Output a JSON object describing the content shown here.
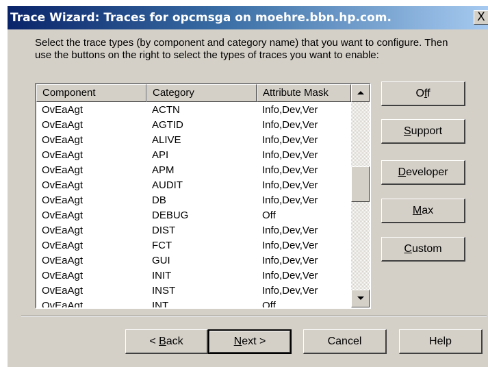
{
  "window": {
    "title": "Trace Wizard: Traces for opcmsga on moehre.bbn.hp.com.",
    "close_label": "X"
  },
  "instructions": "Select the trace types (by component and category name) that you want to configure.  Then use the buttons on the right to select the types of traces you want to enable:",
  "list": {
    "columns": [
      "Component",
      "Category",
      "Attribute Mask"
    ],
    "rows": [
      {
        "component": "OvEaAgt",
        "category": "ACTN",
        "mask": "Info,Dev,Ver"
      },
      {
        "component": "OvEaAgt",
        "category": "AGTID",
        "mask": "Info,Dev,Ver"
      },
      {
        "component": "OvEaAgt",
        "category": "ALIVE",
        "mask": "Info,Dev,Ver"
      },
      {
        "component": "OvEaAgt",
        "category": "API",
        "mask": "Info,Dev,Ver"
      },
      {
        "component": "OvEaAgt",
        "category": "APM",
        "mask": "Info,Dev,Ver"
      },
      {
        "component": "OvEaAgt",
        "category": "AUDIT",
        "mask": "Info,Dev,Ver"
      },
      {
        "component": "OvEaAgt",
        "category": "DB",
        "mask": "Info,Dev,Ver"
      },
      {
        "component": "OvEaAgt",
        "category": "DEBUG",
        "mask": "Off"
      },
      {
        "component": "OvEaAgt",
        "category": "DIST",
        "mask": "Info,Dev,Ver"
      },
      {
        "component": "OvEaAgt",
        "category": "FCT",
        "mask": "Info,Dev,Ver"
      },
      {
        "component": "OvEaAgt",
        "category": "GUI",
        "mask": "Info,Dev,Ver"
      },
      {
        "component": "OvEaAgt",
        "category": "INIT",
        "mask": "Info,Dev,Ver"
      },
      {
        "component": "OvEaAgt",
        "category": "INST",
        "mask": "Info,Dev,Ver"
      },
      {
        "component": "OvEaAgt",
        "category": "INT",
        "mask": "Off"
      }
    ]
  },
  "side_buttons": {
    "off": {
      "pre": "O",
      "key": "f",
      "post": "f"
    },
    "support": {
      "pre": "",
      "key": "S",
      "post": "upport"
    },
    "developer": {
      "pre": "",
      "key": "D",
      "post": "eveloper"
    },
    "max": {
      "pre": "",
      "key": "M",
      "post": "ax"
    },
    "custom": {
      "pre": "",
      "key": "C",
      "post": "ustom"
    }
  },
  "bottom_buttons": {
    "back": {
      "pre": "< ",
      "key": "B",
      "post": "ack"
    },
    "next": {
      "pre": "",
      "key": "N",
      "post": "ext >"
    },
    "cancel": "Cancel",
    "help": "Help"
  },
  "colors": {
    "dialog_face": "#d4d0c8",
    "title_gradient_start": "#0a246a",
    "title_gradient_end": "#a6caf0"
  }
}
